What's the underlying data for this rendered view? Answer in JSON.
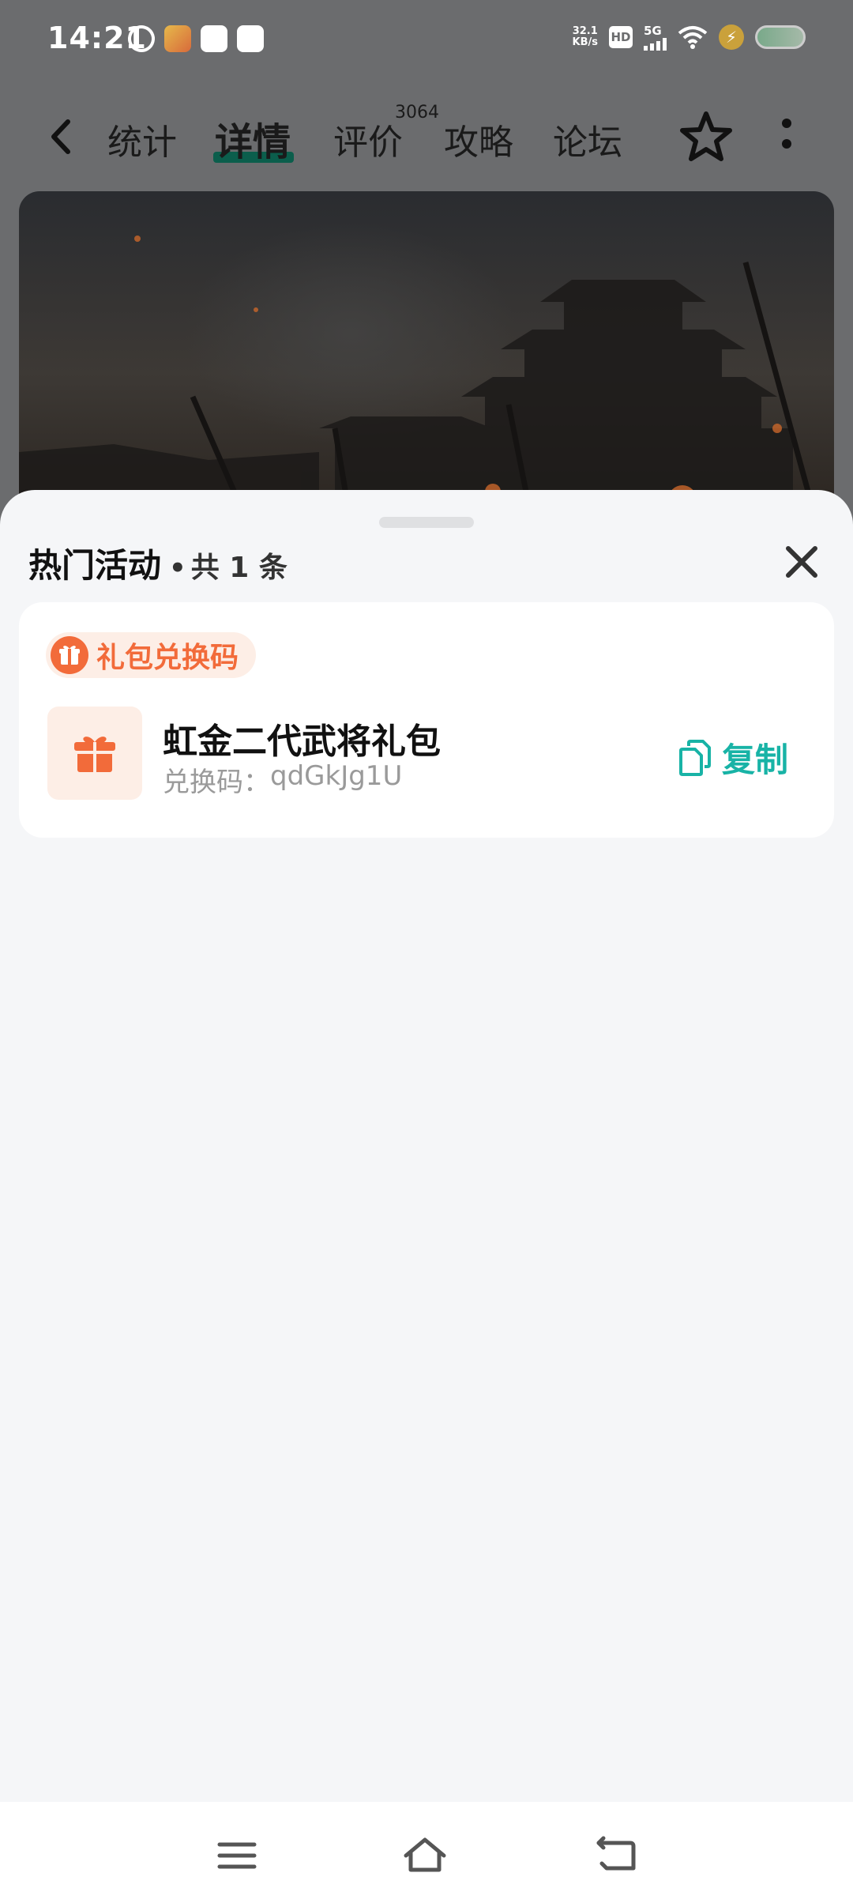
{
  "status_bar": {
    "time": "14:21",
    "net_speed_value": "32.1",
    "net_speed_unit": "KB/s",
    "hd": "HD",
    "network": "5G"
  },
  "top_nav": {
    "tabs": [
      {
        "label": "统计"
      },
      {
        "label": "详情",
        "active": true
      },
      {
        "label": "评价",
        "count": "3064"
      },
      {
        "label": "攻略"
      },
      {
        "label": "论坛"
      }
    ],
    "accent_color": "#0b5e4c"
  },
  "sheet": {
    "title": "热门活动",
    "separator": "•",
    "count_text": "共 1 条",
    "card": {
      "tag_label": "礼包兑换码",
      "tag_color": "#f26b3a",
      "gift_name": "虹金二代武将礼包",
      "code_label": "兑换码：",
      "code_value": "qdGkJg1U",
      "copy_label": "复制",
      "copy_color": "#18b3a6"
    }
  },
  "icons": {
    "back": "chevron-left-icon",
    "favorite": "star-icon",
    "more": "more-vertical-icon",
    "close": "close-icon",
    "gift": "gift-icon",
    "copy": "copy-icon",
    "menu": "menu-icon",
    "home": "home-icon",
    "return": "return-icon"
  }
}
